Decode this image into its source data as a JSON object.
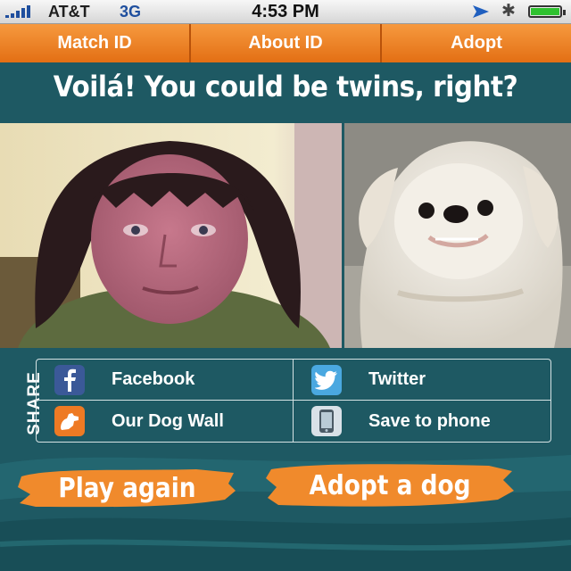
{
  "status_bar": {
    "carrier": "AT&T",
    "network": "3G",
    "time": "4:53 PM"
  },
  "tabs": [
    {
      "label": "Match ID"
    },
    {
      "label": "About ID"
    },
    {
      "label": "Adopt"
    }
  ],
  "headline": "Voilá! You could be twins, right?",
  "share": {
    "label": "SHARE",
    "items": [
      {
        "label": "Facebook",
        "icon": "facebook-icon"
      },
      {
        "label": "Twitter",
        "icon": "twitter-icon"
      },
      {
        "label": "Our Dog Wall",
        "icon": "dog-wall-icon"
      },
      {
        "label": "Save to phone",
        "icon": "phone-icon"
      }
    ]
  },
  "actions": {
    "play_again": "Play again",
    "adopt_dog": "Adopt a dog"
  },
  "colors": {
    "accent_orange": "#f08a2c",
    "background_teal": "#1e5963",
    "tab_orange": "#e87a1e"
  }
}
